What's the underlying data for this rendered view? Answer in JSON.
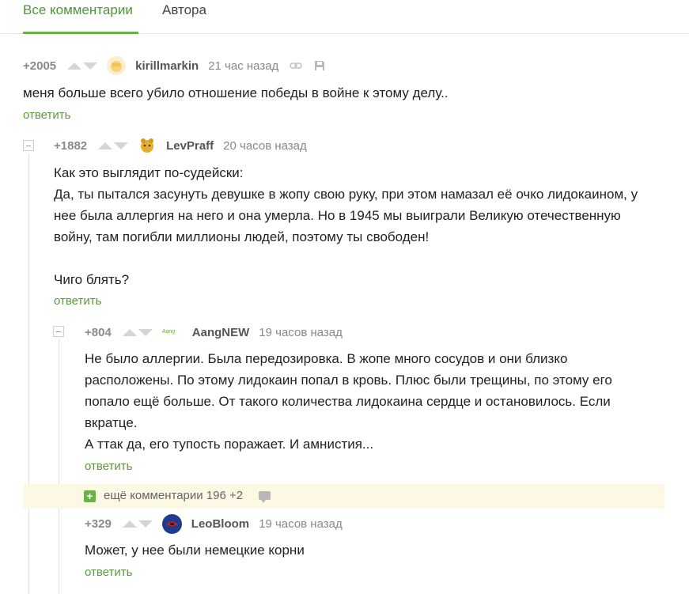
{
  "tabs": {
    "all": "Все комментарии",
    "author": "Автора"
  },
  "comments": [
    {
      "rating": "+2005",
      "author": "kirillmarkin",
      "time": "21 час назад",
      "lines": [
        "меня больше всего убило отношение победы в войне к этому делу.."
      ],
      "reply": "ответить"
    },
    {
      "rating": "+1882",
      "author": "LevPraff",
      "time": "20 часов назад",
      "lines": [
        "Как это выглядит по-судейски:",
        "Да, ты пытался засунуть девушке в жопу свою руку, при этом намазал её очко лидокаином, у",
        "нее была аллергия на него и она умерла. Но в 1945 мы выиграли Великую отечественную",
        "войну, там погибли миллионы людей, поэтому ты свободен!",
        "",
        "Чиго блять?"
      ],
      "reply": "ответить"
    },
    {
      "rating": "+804",
      "author": "AangNEW",
      "avatar_text": "Aang",
      "time": "19 часов назад",
      "lines": [
        "Не было аллергии. Была передозировка. В жопе много сосудов и они близко",
        "расположены. По этому лидокаин попал в кровь. Плюс были трещины, по этому его",
        "попало ещё больше. От такого количества лидокаина сердце и остановилось. Если",
        "вкратце.",
        "А ттак да, его тупость поражает. И амнистия..."
      ],
      "reply": "ответить"
    },
    {
      "rating": "+329",
      "author": "LeoBloom",
      "time": "19 часов назад",
      "lines": [
        "Может, у нее были немецкие корни"
      ],
      "reply": "ответить"
    }
  ],
  "more_comments": {
    "label": "ещё комментарии 196",
    "new": "+2"
  },
  "colors": {
    "accent": "#6cb04a",
    "link": "#5b9a3c",
    "highlight": "#fcf8e3"
  }
}
